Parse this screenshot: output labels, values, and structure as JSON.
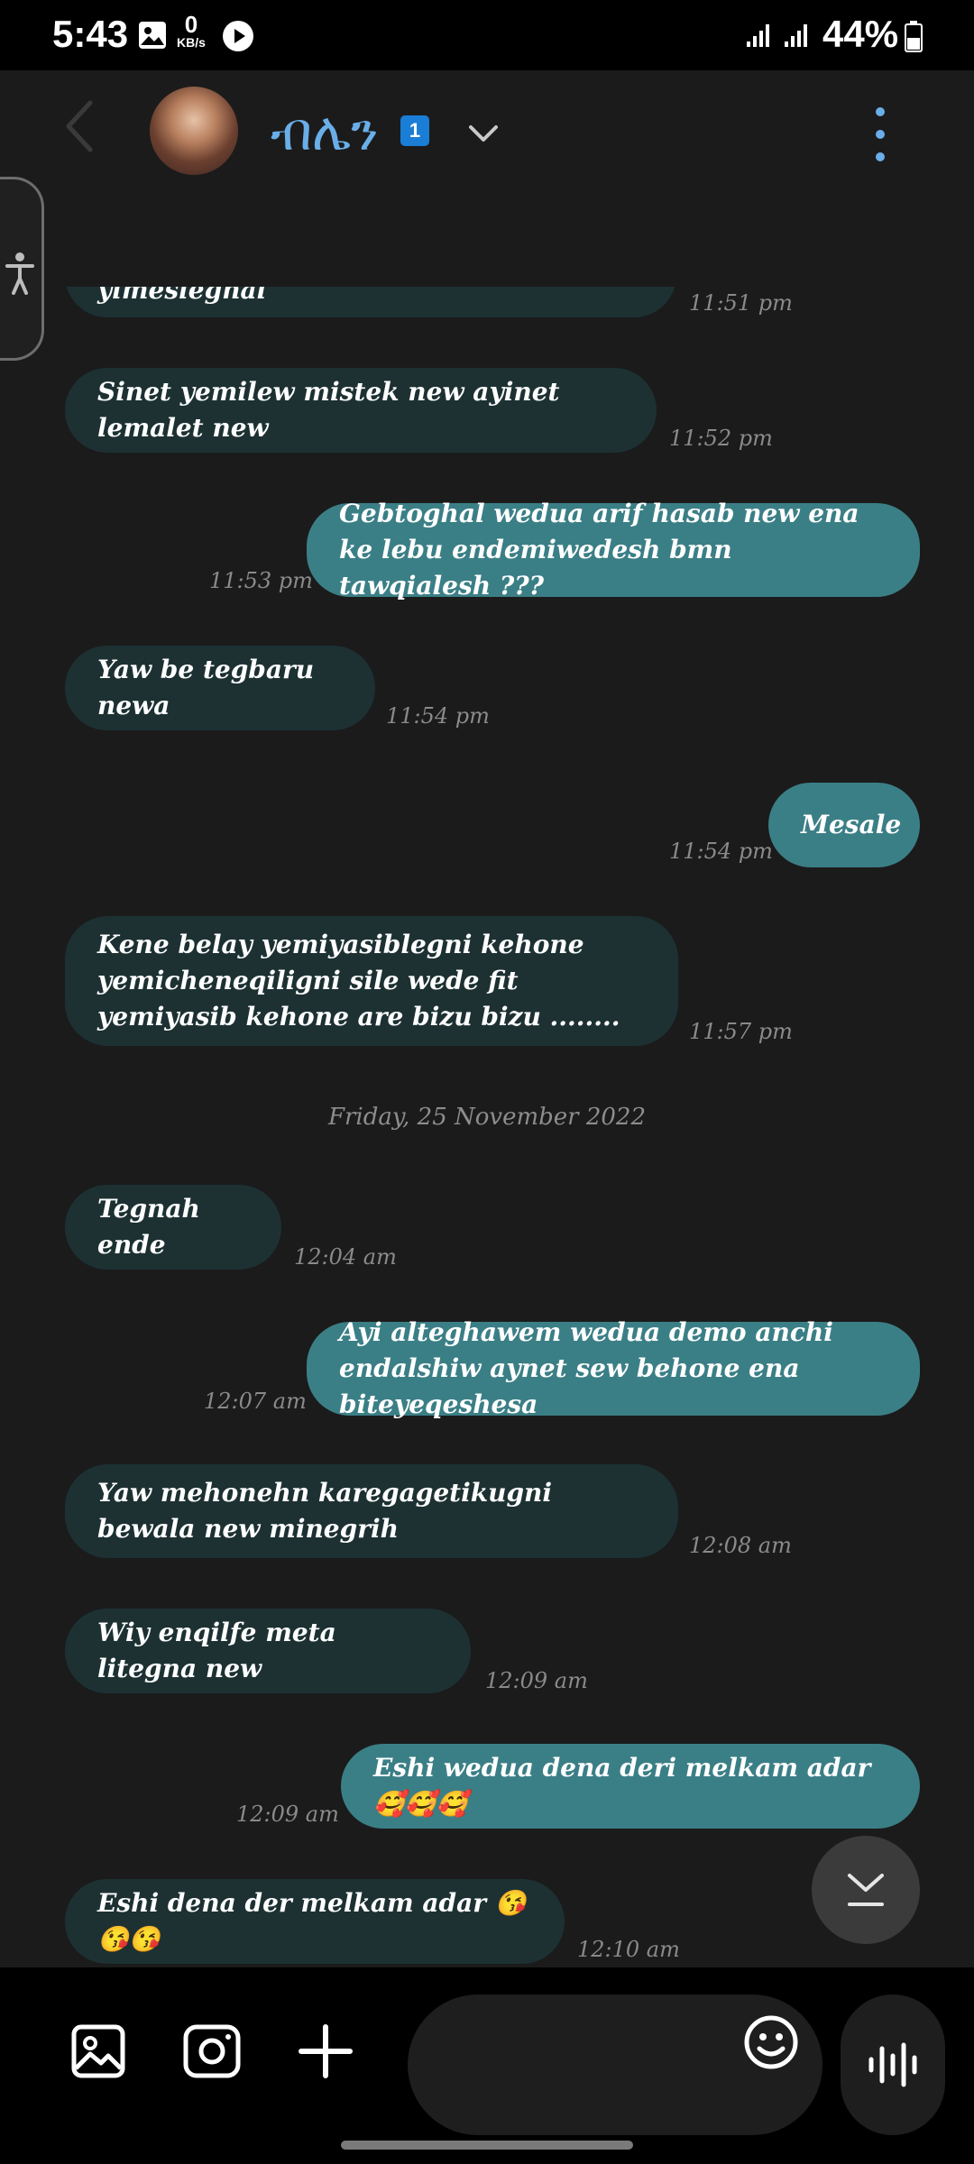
{
  "status_bar": {
    "time": "5:43",
    "net_speed_value": "0",
    "net_speed_unit": "KB/s",
    "battery_percent": "44%"
  },
  "header": {
    "contact_name": "ብሌን",
    "unread_badge": "1"
  },
  "messages": [
    {
      "direction": "in",
      "text": "yimesiegnal",
      "time": "11:51 pm"
    },
    {
      "direction": "in",
      "text": "Sinet yemilew mistek new ayinet lemalet new",
      "time": "11:52 pm"
    },
    {
      "direction": "out",
      "text": "Gebtoghal wedua arif hasab new ena ke lebu endemiwedesh bmn tawqialesh ???",
      "time": "11:53 pm"
    },
    {
      "direction": "in",
      "text": "Yaw be tegbaru newa",
      "time": "11:54 pm"
    },
    {
      "direction": "out",
      "text": "Mesale",
      "time": "11:54 pm"
    },
    {
      "direction": "in",
      "text": "Kene belay yemiyasiblegni kehone yemicheneqiligni sile wede fit yemiyasib kehone are bizu bizu ........",
      "time": "11:57 pm"
    },
    {
      "direction": "in",
      "text": "Tegnah ende",
      "time": "12:04 am"
    },
    {
      "direction": "out",
      "text": "Ayi alteghawem wedua demo anchi endalshiw aynet sew behone ena biteyeqeshesa",
      "time": "12:07 am"
    },
    {
      "direction": "in",
      "text": "Yaw mehonehn karegagetikugni bewala new minegrih",
      "time": "12:08 am"
    },
    {
      "direction": "in",
      "text": "Wiy enqilfe meta litegna new",
      "time": "12:09 am"
    },
    {
      "direction": "out",
      "text": "Eshi wedua dena deri melkam adar 🥰🥰🥰",
      "time": "12:09 am"
    },
    {
      "direction": "in",
      "text": "Eshi dena der  melkam adar 😘😘😘",
      "time": "12:10 am"
    }
  ],
  "date_separator": "Friday, 25 November 2022",
  "composer": {
    "placeholder": ""
  },
  "icons": [
    "back-icon",
    "chevron-down-icon",
    "more-vert-icon",
    "accessibility-icon",
    "scroll-down-icon",
    "gallery-icon",
    "camera-icon",
    "plus-icon",
    "emoji-icon",
    "voice-icon"
  ],
  "colors": {
    "incoming_bubble": "#1d3133",
    "outgoing_bubble": "#3b7f86",
    "contact_name": "#6aaee8",
    "badge": "#1a7dd6",
    "background": "#1b1b1c"
  }
}
